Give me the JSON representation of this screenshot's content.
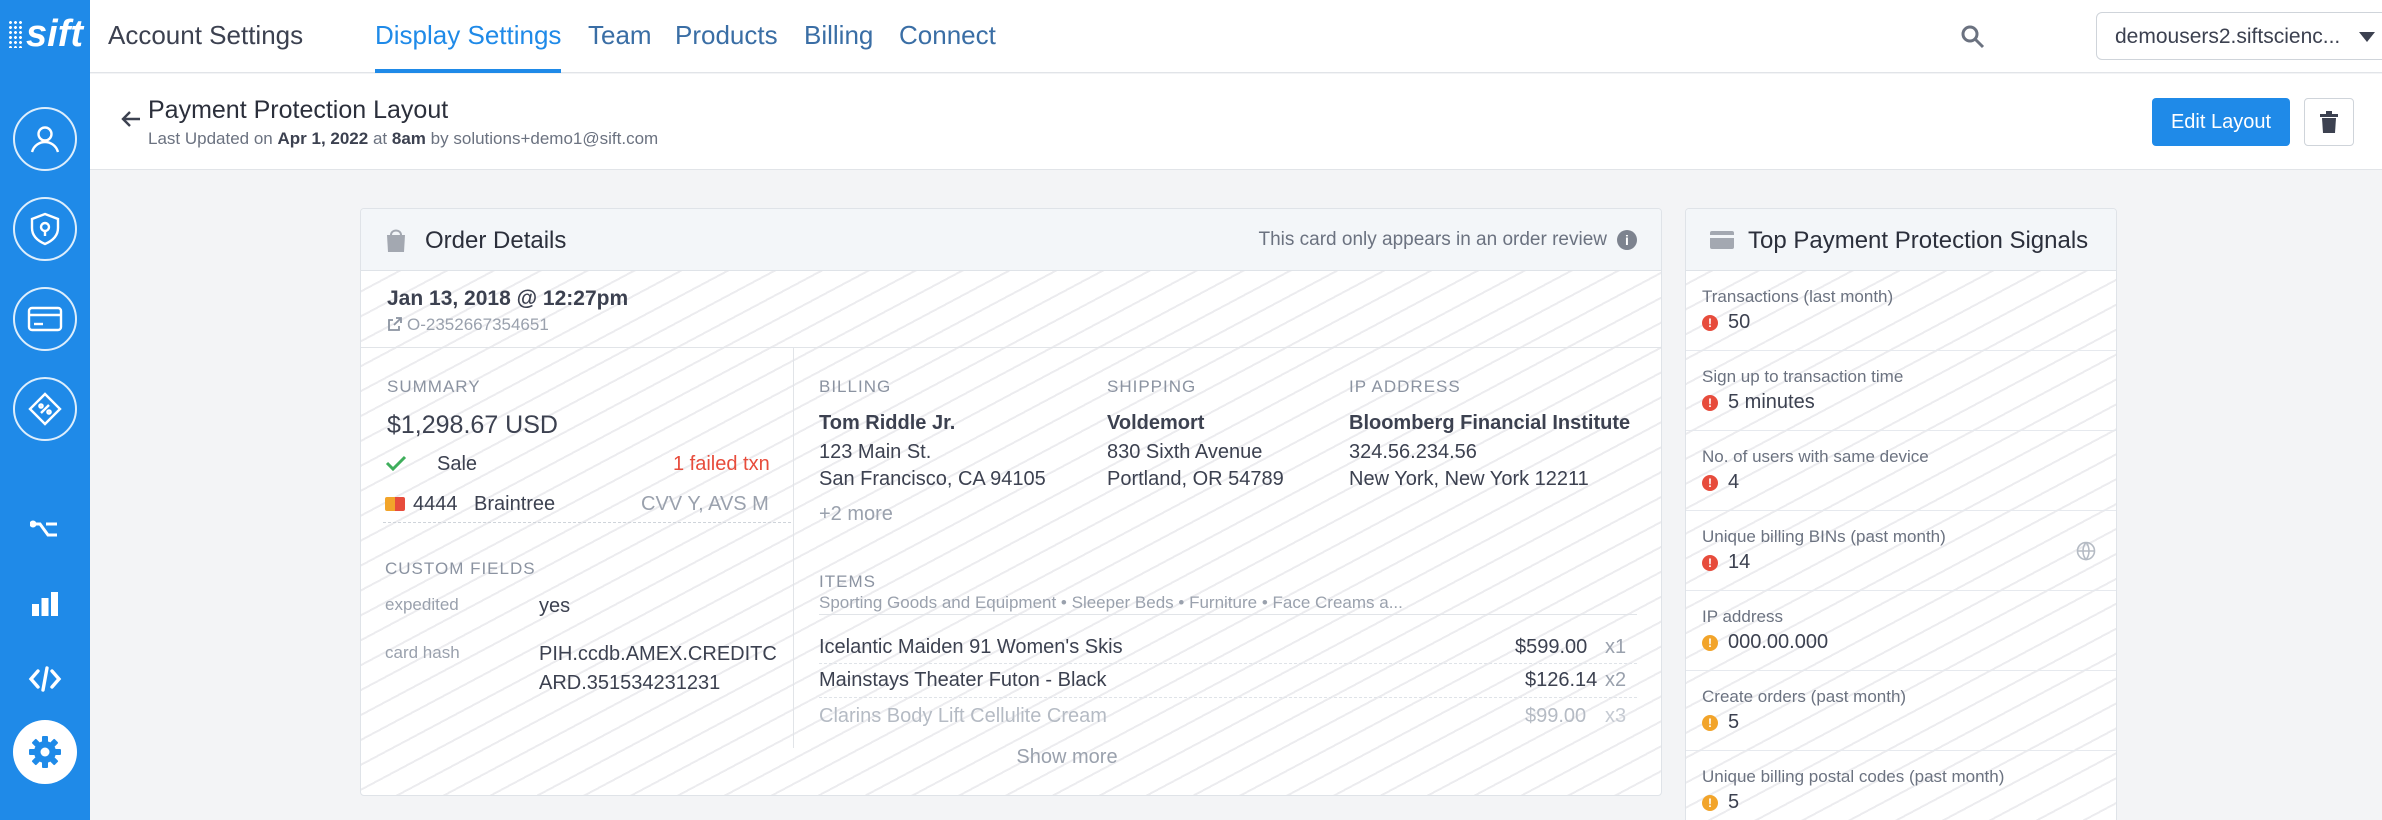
{
  "brand": {
    "logo_text": "sift",
    "accent": "#1f8ae8",
    "error": "#e74c3c",
    "warning": "#f2a42a"
  },
  "sidebar": {
    "items": [
      {
        "name": "user-icon"
      },
      {
        "name": "shield-icon"
      },
      {
        "name": "credit-card-icon"
      },
      {
        "name": "promo-tag-icon"
      },
      {
        "name": "workflow-icon"
      },
      {
        "name": "bar-chart-icon"
      },
      {
        "name": "code-icon"
      },
      {
        "name": "gear-icon"
      }
    ]
  },
  "nav": {
    "title": "Account Settings",
    "tabs": [
      "Display Settings",
      "Team",
      "Products",
      "Billing",
      "Connect"
    ],
    "account": "demousers2.siftscienc..."
  },
  "header": {
    "title": "Payment Protection Layout",
    "updated_prefix": "Last Updated on",
    "updated_date": "Apr 1, 2022",
    "updated_at": "at",
    "updated_time": "8am",
    "updated_by_prefix": "by",
    "updated_by": "solutions+demo1@sift.com",
    "edit_button": "Edit Layout"
  },
  "order_card": {
    "title": "Order Details",
    "note": "This card only appears in an order review",
    "date": "Jan 13, 2018 @ 12:27pm",
    "order_id": "O-2352667354651",
    "summary": {
      "label": "SUMMARY",
      "amount": "$1,298.67 USD",
      "status": "Sale",
      "failed": "1 failed txn",
      "card_last4": "4444",
      "gateway": "Braintree",
      "checks": "CVV Y, AVS M"
    },
    "custom_fields": {
      "label": "CUSTOM FIELDS",
      "rows": [
        {
          "key": "expedited",
          "value": "yes"
        },
        {
          "key": "card hash",
          "value_line1": "PIH.ccdb.AMEX.CREDITC",
          "value_line2": "ARD.351534231231"
        }
      ]
    },
    "billing": {
      "label": "BILLING",
      "name": "Tom Riddle Jr.",
      "line1": "123 Main St.",
      "line2": "San Francisco, CA 94105",
      "more": "+2 more"
    },
    "shipping": {
      "label": "SHIPPING",
      "name": "Voldemort",
      "line1": "830 Sixth Avenue",
      "line2": "Portland, OR 54789"
    },
    "ip": {
      "label": "IP ADDRESS",
      "name": "Bloomberg Financial Institute",
      "line1": "324.56.234.56",
      "line2": "New York, New York 12211"
    },
    "items": {
      "label": "ITEMS",
      "categories": "Sporting Goods and Equipment • Sleeper Beds • Furniture • Face Creams a...",
      "rows": [
        {
          "name": "Icelantic Maiden 91 Women's Skis",
          "price": "$599.00",
          "qty": "x1"
        },
        {
          "name": "Mainstays Theater Futon - Black",
          "price": "$126.14",
          "qty": "x2"
        },
        {
          "name": "Clarins Body Lift Cellulite Cream",
          "price": "$99.00",
          "qty": "x3"
        }
      ],
      "show_more": "Show more"
    }
  },
  "signals_card": {
    "title": "Top Payment Protection Signals",
    "signals": [
      {
        "label": "Transactions (last month)",
        "value": "50",
        "level": "error"
      },
      {
        "label": "Sign up to transaction time",
        "value": "5 minutes",
        "level": "error"
      },
      {
        "label": "No. of users with same device",
        "value": "4",
        "level": "error"
      },
      {
        "label": "Unique billing BINs (past month)",
        "value": "14",
        "level": "error"
      },
      {
        "label": "IP address",
        "value": "000.00.000",
        "level": "warning"
      },
      {
        "label": "Create orders (past month)",
        "value": "5",
        "level": "warning"
      },
      {
        "label": "Unique billing postal codes (past month)",
        "value": "5",
        "level": "warning"
      }
    ]
  }
}
